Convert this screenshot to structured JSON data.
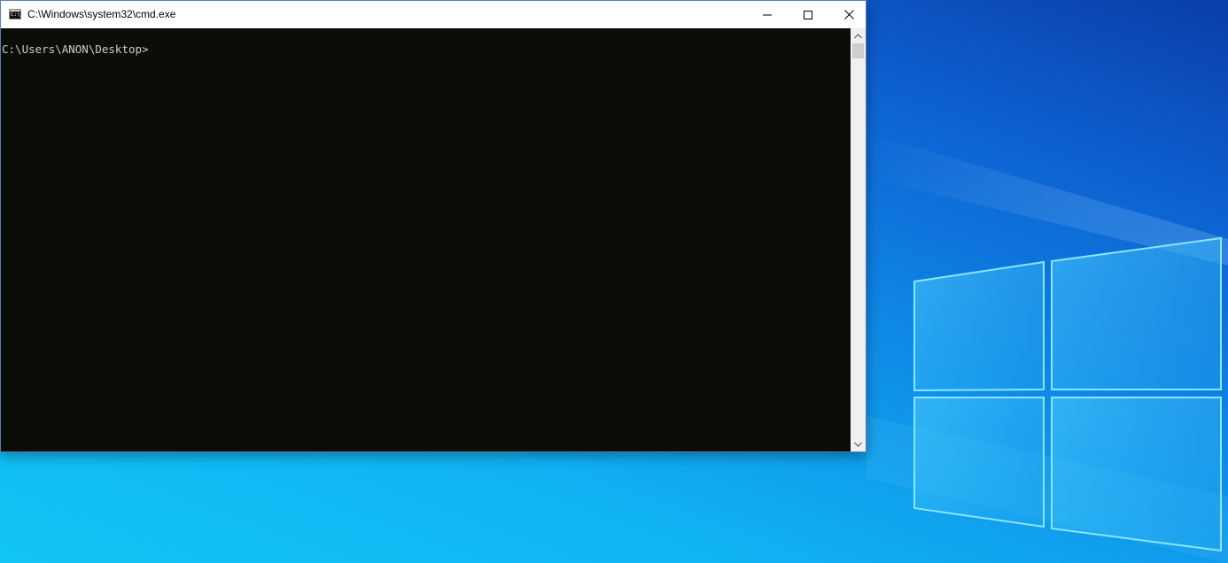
{
  "window": {
    "title": "C:\\Windows\\system32\\cmd.exe",
    "icon": "cmd-icon",
    "icon_glyph": "C:\\_"
  },
  "console": {
    "text": "C:\\Users\\ANON\\Desktop>"
  },
  "caption_buttons": {
    "minimize": "minimize-icon",
    "maximize": "maximize-icon",
    "close": "close-icon"
  },
  "colors": {
    "console_background": "#0c0c08",
    "console_foreground": "#cccccc",
    "wallpaper_accent": "#10b2f2"
  }
}
